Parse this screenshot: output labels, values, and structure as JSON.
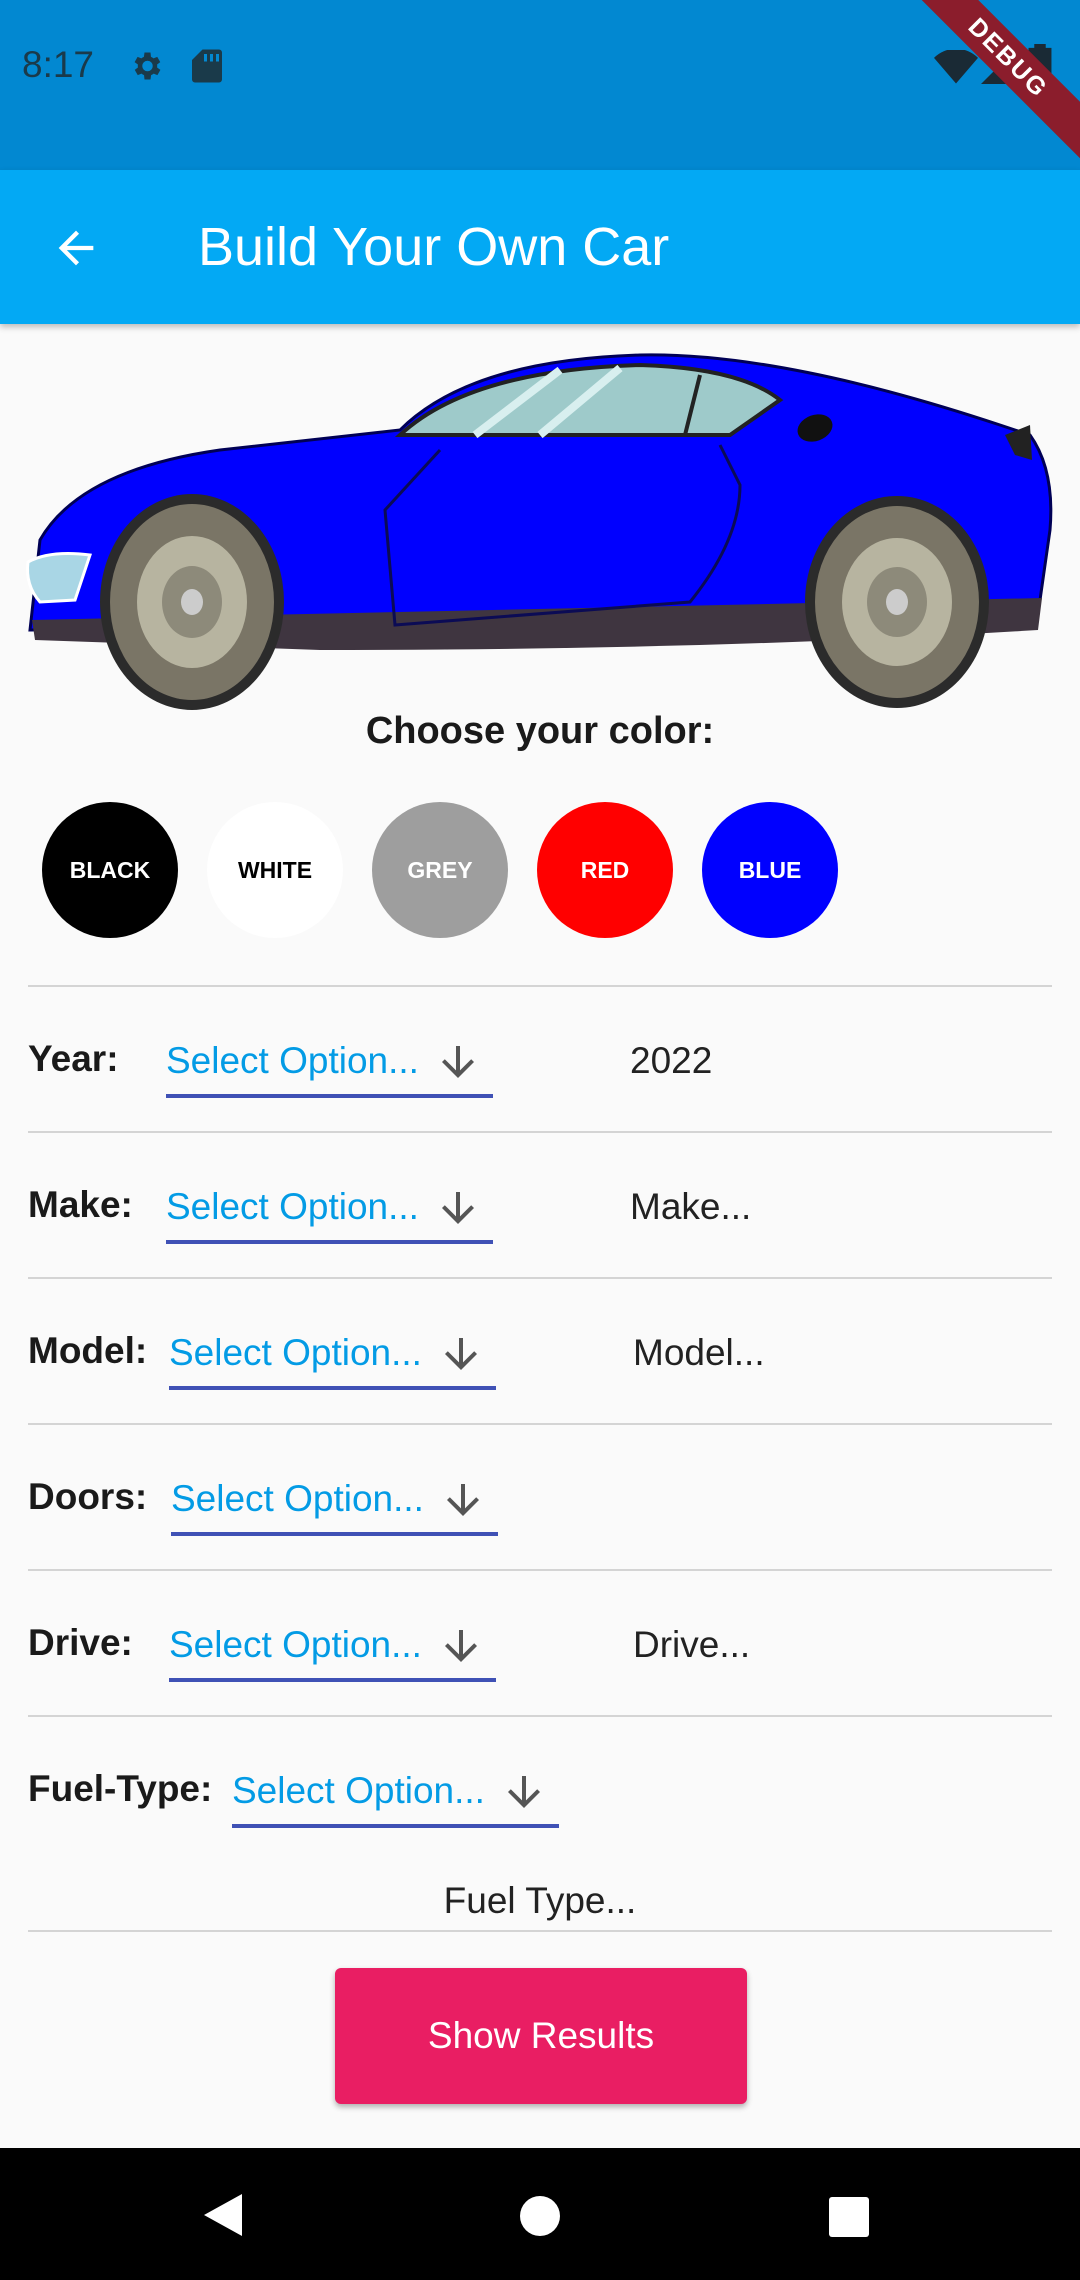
{
  "status_bar": {
    "time": "8:17",
    "debug_label": "DEBUG"
  },
  "app_bar": {
    "title": "Build Your Own Car",
    "back_icon": "arrow-back-icon"
  },
  "car": {
    "color": "#0000ff"
  },
  "color_picker": {
    "heading": "Choose your color:",
    "options": [
      {
        "label": "BLACK",
        "bg": "#000000",
        "fg": "#ffffff"
      },
      {
        "label": "WHITE",
        "bg": "#ffffff",
        "fg": "#000000"
      },
      {
        "label": "GREY",
        "bg": "#9e9e9e",
        "fg": "#ffffff"
      },
      {
        "label": "RED",
        "bg": "#ff0000",
        "fg": "#ffffff"
      },
      {
        "label": "BLUE",
        "bg": "#0000ff",
        "fg": "#ffffff"
      }
    ]
  },
  "form": {
    "placeholder": "Select Option...",
    "rows": [
      {
        "label": "Year:",
        "value": "2022"
      },
      {
        "label": "Make:",
        "value": "Make..."
      },
      {
        "label": "Model:",
        "value": "Model..."
      },
      {
        "label": "Doors:",
        "value": ""
      },
      {
        "label": "Drive:",
        "value": "Drive..."
      },
      {
        "label": "Fuel-Type:",
        "value": "Fuel Type..."
      }
    ]
  },
  "actions": {
    "show_results": "Show Results"
  },
  "colors": {
    "primary_dark": "#0288d1",
    "primary": "#03a9f4",
    "accent": "#e91e63",
    "underline": "#3f51b5",
    "dropdown_text": "#039be5"
  }
}
